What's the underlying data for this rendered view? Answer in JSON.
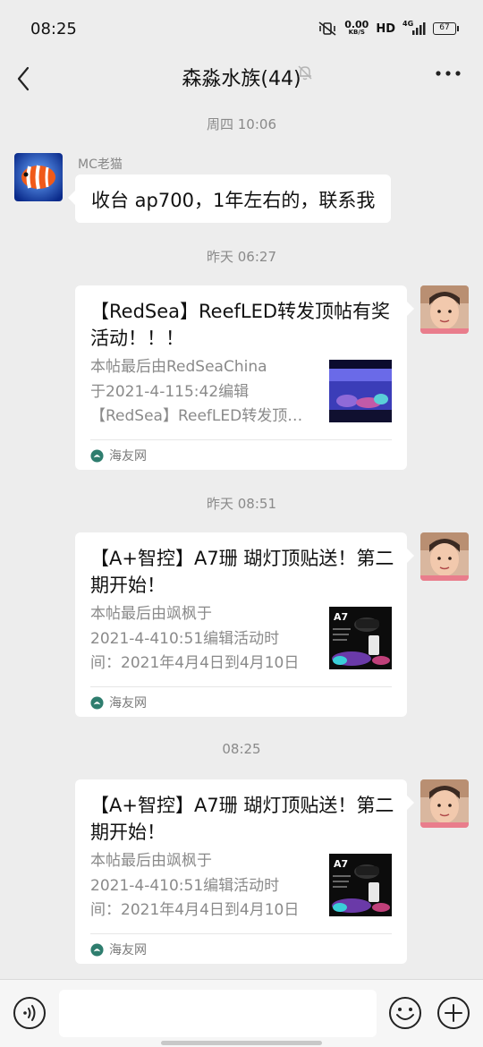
{
  "status_bar": {
    "time": "08:25",
    "net_speed_value": "0.00",
    "net_speed_unit": "KB/S",
    "hd": "HD",
    "network": "4G",
    "battery": "67"
  },
  "header": {
    "title": "森淼水族(44)"
  },
  "messages": [
    {
      "timestamp": "周四 10:06",
      "sender": "MC老猫",
      "text": "收台 ap700，1年左右的，联系我"
    },
    {
      "timestamp": "昨天 06:27",
      "card": {
        "title": "【RedSea】ReefLED转发顶帖有奖活动！！！",
        "desc_lines": [
          "本帖最后由RedSeaChina",
          "于2021-4-115:42编辑",
          "【RedSea】ReefLED转发顶帖有奖活动！！！"
        ],
        "source": "海友网"
      }
    },
    {
      "timestamp": "昨天 08:51",
      "card": {
        "title": "【A+智控】A7珊 瑚灯顶贴送！第二期开始！",
        "desc_lines": [
          "本帖最后由飒枫于",
          "2021-4-410:51编辑活动时",
          "间：2021年4月4日到4月10日"
        ],
        "thumb_label": "A7",
        "source": "海友网"
      }
    },
    {
      "timestamp": "08:25",
      "card": {
        "title": "【A+智控】A7珊 瑚灯顶贴送！第二期开始！",
        "desc_lines": [
          "本帖最后由飒枫于",
          "2021-4-410:51编辑活动时",
          "间：2021年4月4日到4月10日"
        ],
        "thumb_label": "A7",
        "source": "海友网"
      }
    }
  ],
  "input": {
    "value": "",
    "placeholder": ""
  },
  "colors": {
    "background": "#ededed",
    "bubble": "#ffffff",
    "muted_text": "#8a8a8a",
    "source_icon": "#2e7d6e"
  }
}
